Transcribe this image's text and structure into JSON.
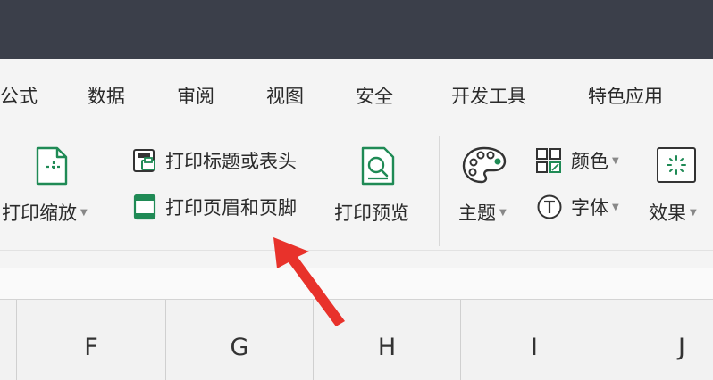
{
  "menu": {
    "items": [
      "公式",
      "数据",
      "审阅",
      "视图",
      "安全",
      "开发工具",
      "特色应用"
    ]
  },
  "ribbon": {
    "print_scale": "打印缩放",
    "print_titles": "打印标题或表头",
    "print_header_footer": "打印页眉和页脚",
    "print_preview": "打印预览",
    "theme": "主题",
    "colors": "颜色",
    "font": "字体",
    "effects": "效果"
  },
  "columns": [
    "F",
    "G",
    "H",
    "I",
    "J"
  ],
  "colors": {
    "titlebar": "#3b3f4a",
    "icon_green": "#1f8a55",
    "arrow_red": "#e8322b"
  }
}
